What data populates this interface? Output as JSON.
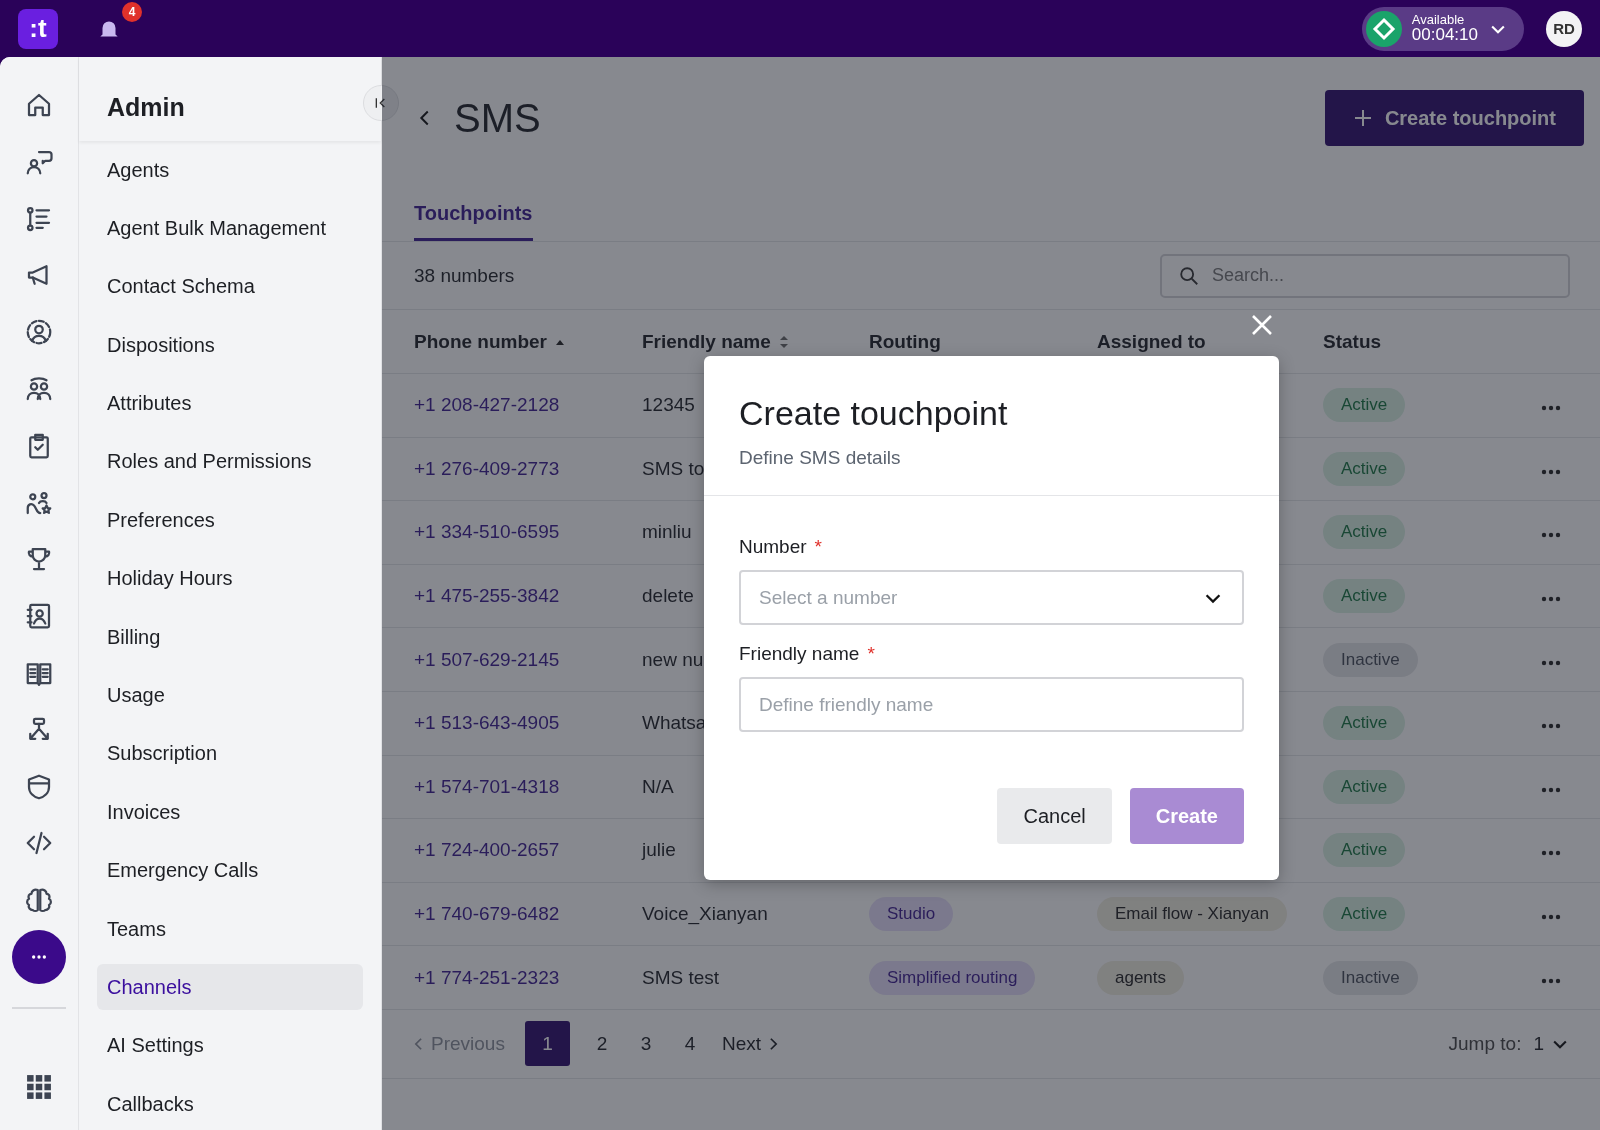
{
  "topbar": {
    "logo": ":t",
    "notifications": "4",
    "status": {
      "label": "Available",
      "timer": "00:04:10"
    },
    "avatar": "RD"
  },
  "sidebar": {
    "title": "Admin",
    "items": [
      {
        "label": "Agents",
        "selected": false
      },
      {
        "label": "Agent Bulk Management",
        "selected": false
      },
      {
        "label": "Contact Schema",
        "selected": false
      },
      {
        "label": "Dispositions",
        "selected": false
      },
      {
        "label": "Attributes",
        "selected": false
      },
      {
        "label": "Roles and Permissions",
        "selected": false
      },
      {
        "label": "Preferences",
        "selected": false
      },
      {
        "label": "Holiday Hours",
        "selected": false
      },
      {
        "label": "Billing",
        "selected": false
      },
      {
        "label": "Usage",
        "selected": false
      },
      {
        "label": "Subscription",
        "selected": false
      },
      {
        "label": "Invoices",
        "selected": false
      },
      {
        "label": "Emergency Calls",
        "selected": false
      },
      {
        "label": "Teams",
        "selected": false
      },
      {
        "label": "Channels",
        "selected": true
      },
      {
        "label": "AI Settings",
        "selected": false
      },
      {
        "label": "Callbacks",
        "selected": false
      }
    ]
  },
  "page": {
    "title": "SMS",
    "create_button": "Create touchpoint",
    "tabs": [
      {
        "label": "Touchpoints",
        "selected": true
      }
    ],
    "count": "38 numbers",
    "search": {
      "placeholder": "Search..."
    },
    "table": {
      "columns": [
        {
          "label": "Phone number",
          "sorted": true
        },
        {
          "label": "Friendly name",
          "sortable": true,
          "sorted": false
        },
        {
          "label": "Routing"
        },
        {
          "label": "Assigned to"
        },
        {
          "label": "Status"
        }
      ],
      "rows": [
        {
          "phone": "+1 208-427-2128",
          "friendly_name": "12345",
          "status": {
            "label": "Active",
            "kind": "active"
          }
        },
        {
          "phone": "+1 276-409-2773",
          "friendly_name": "SMS to",
          "status": {
            "label": "Active",
            "kind": "active"
          }
        },
        {
          "phone": "+1 334-510-6595",
          "friendly_name": "minliu",
          "status": {
            "label": "Active",
            "kind": "active"
          }
        },
        {
          "phone": "+1 475-255-3842",
          "friendly_name": "delete",
          "status": {
            "label": "Active",
            "kind": "active"
          }
        },
        {
          "phone": "+1 507-629-2145",
          "friendly_name": "new nu",
          "status": {
            "label": "Inactive",
            "kind": "inactive"
          }
        },
        {
          "phone": "+1 513-643-4905",
          "friendly_name": "Whatsa",
          "status": {
            "label": "Active",
            "kind": "active"
          }
        },
        {
          "phone": "+1 574-701-4318",
          "friendly_name": "N/A",
          "status": {
            "label": "Active",
            "kind": "active"
          }
        },
        {
          "phone": "+1 724-400-2657",
          "friendly_name": "julie",
          "status": {
            "label": "Active",
            "kind": "active"
          }
        },
        {
          "phone": "+1 740-679-6482",
          "friendly_name": "Voice_Xianyan",
          "routing": "Studio",
          "assigned_to": "Email flow - Xianyan",
          "status": {
            "label": "Active",
            "kind": "active"
          }
        },
        {
          "phone": "+1 774-251-2323",
          "friendly_name": "SMS test",
          "routing": "Simplified routing",
          "assigned_to": "agents",
          "status": {
            "label": "Inactive",
            "kind": "inactive"
          }
        }
      ]
    },
    "pagination": {
      "previous": {
        "label": "Previous",
        "disabled": true
      },
      "pages": [
        {
          "label": "1",
          "selected": true
        },
        {
          "label": "2",
          "selected": false
        },
        {
          "label": "3",
          "selected": false
        },
        {
          "label": "4",
          "selected": false
        }
      ],
      "next": {
        "label": "Next",
        "disabled": false
      },
      "jump_label": "Jump to:",
      "jump_value": "1"
    }
  },
  "modal": {
    "title": "Create touchpoint",
    "subtitle": "Define SMS details",
    "fields": [
      {
        "label": "Number",
        "required_mark": "*",
        "kind": "select",
        "placeholder": "Select a number"
      },
      {
        "label": "Friendly name",
        "required_mark": "*",
        "kind": "text",
        "placeholder": "Define friendly name"
      }
    ],
    "buttons": [
      {
        "label": "Cancel",
        "kind": "secondary",
        "disabled": false
      },
      {
        "label": "Create",
        "kind": "primary",
        "disabled": true
      }
    ]
  }
}
